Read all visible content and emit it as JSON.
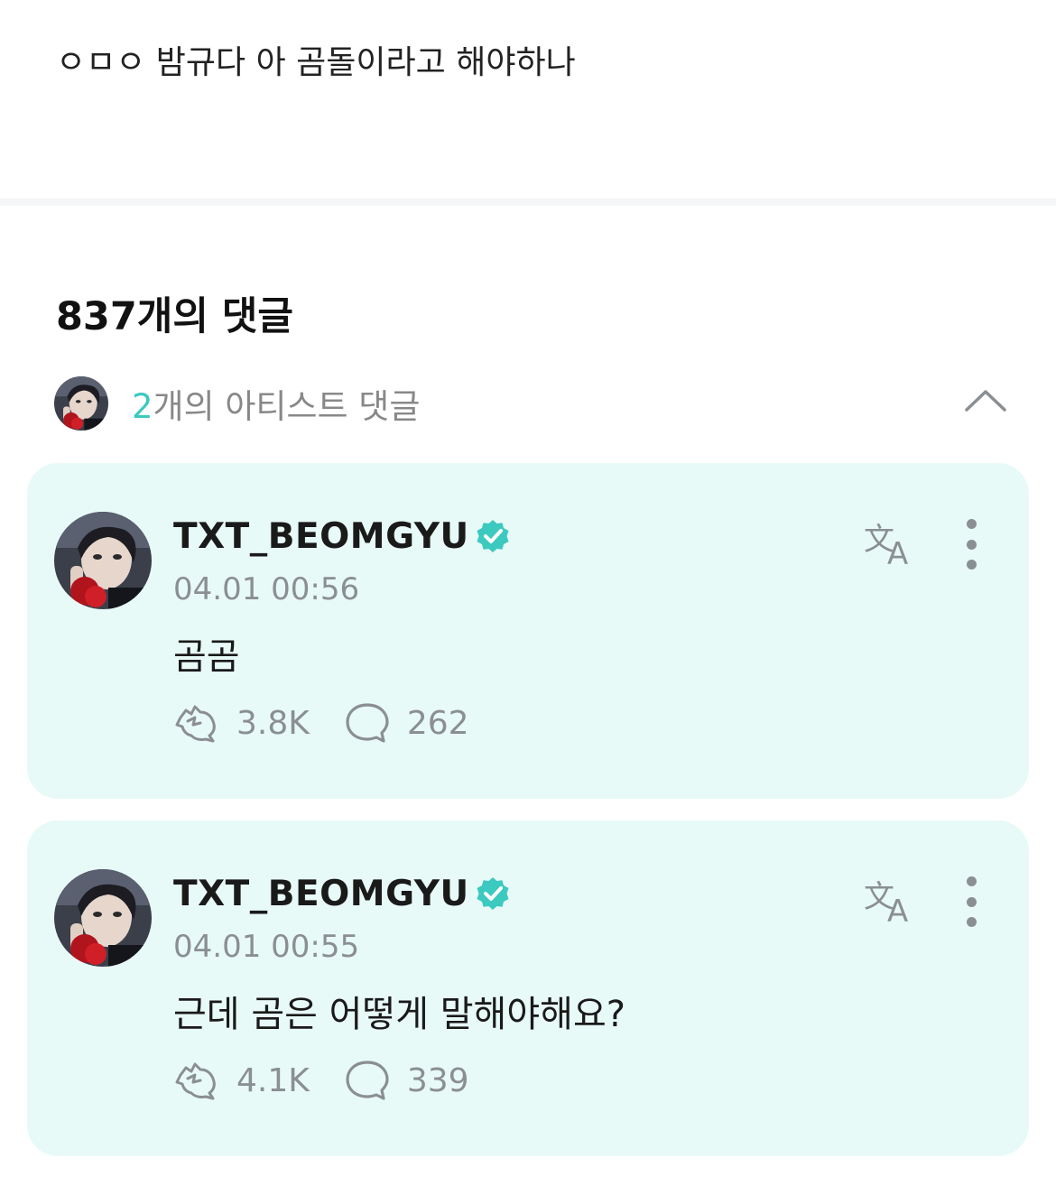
{
  "post": {
    "text": "ㅇㅁㅇ 밤규다 아 곰돌이라고 해야하나"
  },
  "comments_section": {
    "header": "837개의 댓글",
    "artist_toggle": {
      "count": "2",
      "label_rest": "개의 아티스트 댓글",
      "state": "expanded"
    }
  },
  "artist_comments": [
    {
      "username": "TXT_BEOMGYU",
      "timestamp": "04.01 00:56",
      "body": "곰곰",
      "likes": "3.8K",
      "replies": "262"
    },
    {
      "username": "TXT_BEOMGYU",
      "timestamp": "04.01 00:55",
      "body": "근데 곰은 어떻게 말해야해요?",
      "likes": "4.1K",
      "replies": "339"
    }
  ],
  "colors": {
    "accent": "#3cc9c0",
    "card_bg": "#e8faf7",
    "muted": "#8a8f93"
  },
  "icons": [
    "verified-badge-icon",
    "translate-icon",
    "more-vertical-icon",
    "reaction-icon",
    "comment-icon",
    "chevron-up-icon"
  ]
}
